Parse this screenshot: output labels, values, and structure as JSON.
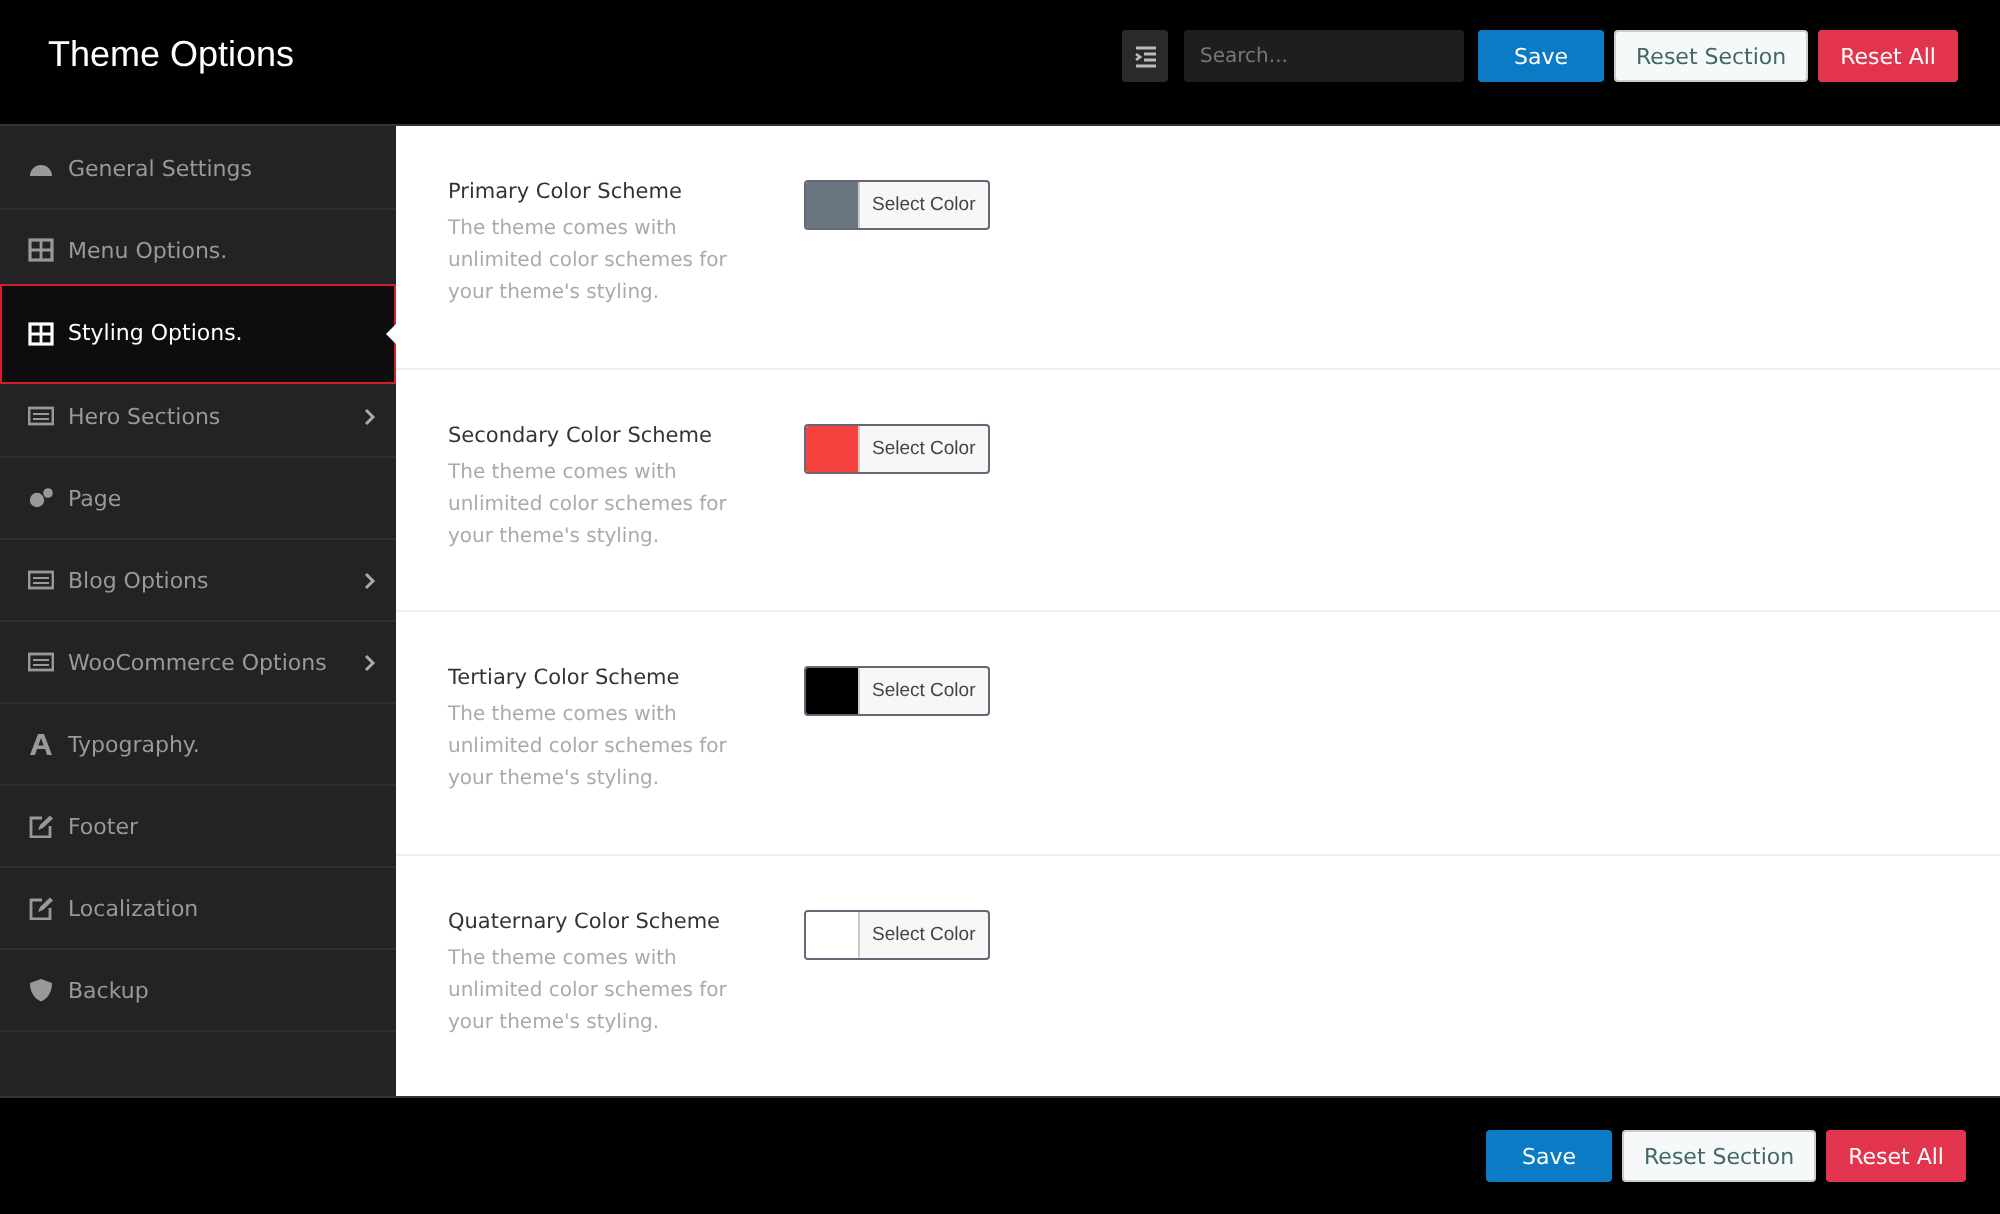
{
  "header": {
    "title": "Theme Options",
    "search": {
      "placeholder": "Search..."
    },
    "buttons": [
      {
        "label": "Save",
        "kind": "save"
      },
      {
        "label": "Reset Section",
        "kind": "reset-section"
      },
      {
        "label": "Reset All",
        "kind": "reset-all"
      }
    ]
  },
  "sidebar": {
    "items": [
      {
        "label": "General Settings",
        "selected": false,
        "has_submenu": false
      },
      {
        "label": "Menu Options.",
        "selected": false,
        "has_submenu": false
      },
      {
        "label": "Styling Options.",
        "selected": true,
        "has_submenu": false
      },
      {
        "label": "Hero Sections",
        "selected": false,
        "has_submenu": true
      },
      {
        "label": "Page",
        "selected": false,
        "has_submenu": false
      },
      {
        "label": "Blog Options",
        "selected": false,
        "has_submenu": true
      },
      {
        "label": "WooCommerce Options",
        "selected": false,
        "has_submenu": true
      },
      {
        "label": "Typography.",
        "selected": false,
        "has_submenu": false
      },
      {
        "label": "Footer",
        "selected": false,
        "has_submenu": false
      },
      {
        "label": "Localization",
        "selected": false,
        "has_submenu": false
      },
      {
        "label": "Backup",
        "selected": false,
        "has_submenu": false
      }
    ]
  },
  "settings": [
    {
      "title": "Primary Color Scheme",
      "description": "The theme comes with unlimited color schemes for your theme's styling.",
      "color": "#6b7580",
      "button": "Select Color"
    },
    {
      "title": "Secondary Color Scheme",
      "description": "The theme comes with unlimited color schemes for your theme's styling.",
      "color": "#f5423f",
      "button": "Select Color"
    },
    {
      "title": "Tertiary Color Scheme",
      "description": "The theme comes with unlimited color schemes for your theme's styling.",
      "color": "#000000",
      "button": "Select Color"
    },
    {
      "title": "Quaternary Color Scheme",
      "description": "The theme comes with unlimited color schemes for your theme's styling.",
      "color": "#ffffff",
      "button": "Select Color"
    }
  ],
  "footer": {
    "buttons": [
      {
        "label": "Save",
        "kind": "save"
      },
      {
        "label": "Reset Section",
        "kind": "reset-section"
      },
      {
        "label": "Reset All",
        "kind": "reset-all"
      }
    ]
  }
}
